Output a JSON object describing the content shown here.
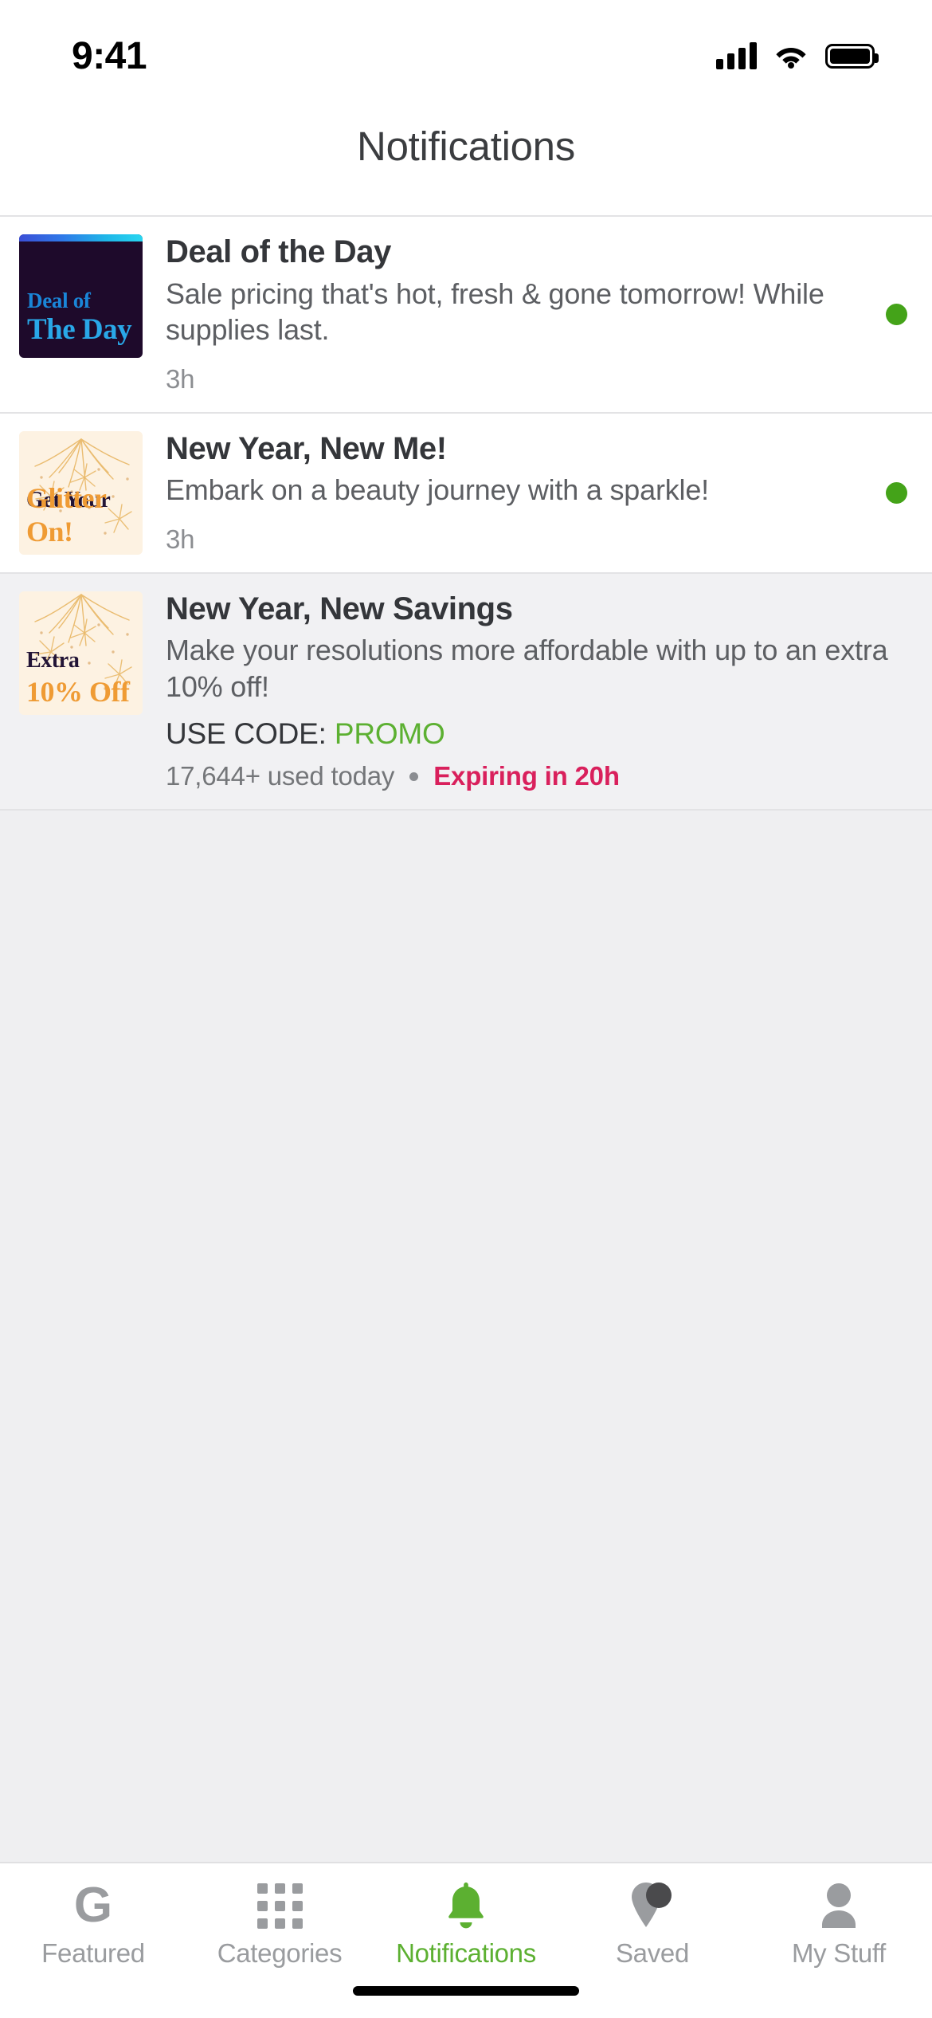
{
  "status_bar": {
    "time": "9:41",
    "cellular_icon": "cellular-signal-icon",
    "wifi_icon": "wifi-icon",
    "battery_icon": "battery-full-icon"
  },
  "header": {
    "title": "Notifications"
  },
  "notifications": [
    {
      "id": "deal-of-the-day",
      "read": false,
      "thumbnail": {
        "type": "deal-banner",
        "line1": "Deal of",
        "line2": "The Day",
        "bg_color": "#1e0a2b",
        "line1_color": "#1a86d8",
        "line2_color": "#29a8e8",
        "accent_gradient_from": "#3b4fd6",
        "accent_gradient_to": "#29d6f0"
      },
      "title": "Deal of the Day",
      "text": "Sale pricing that's hot, fresh & gone tomorrow! While supplies last.",
      "time": "3h",
      "unread_dot_color": "#44a319"
    },
    {
      "id": "new-year-new-me",
      "read": false,
      "thumbnail": {
        "type": "firework-banner",
        "line1": "Get Your",
        "line2": "Glitter On!",
        "bg_color": "#fdf2e2",
        "line1_color": "#221436",
        "line2_color": "#ef9b34"
      },
      "title": "New Year, New Me!",
      "text": "Embark on a beauty journey with a sparkle!",
      "time": "3h",
      "unread_dot_color": "#44a319"
    },
    {
      "id": "new-year-new-savings",
      "read": true,
      "thumbnail": {
        "type": "firework-banner",
        "line1": "Extra",
        "line2": "10% Off",
        "bg_color": "#fdf2e2",
        "line1_color": "#221436",
        "line2_color": "#ef9b34"
      },
      "title": "New Year, New Savings",
      "text": "Make your resolutions more affordable with up to an extra 10% off!",
      "promo": {
        "label": "USE CODE:",
        "code": "PROMO",
        "code_color": "#5cb031",
        "used_text": "17,644+ used today",
        "expiry_text": "Expiring in 20h",
        "expiry_color": "#d9205c"
      }
    }
  ],
  "tabbar": {
    "items": [
      {
        "label": "Featured",
        "icon": "g-logo-icon",
        "active": false
      },
      {
        "label": "Categories",
        "icon": "grid-icon",
        "active": false
      },
      {
        "label": "Notifications",
        "icon": "bell-icon",
        "active": true
      },
      {
        "label": "Saved",
        "icon": "tag-pin-icon",
        "active": false
      },
      {
        "label": "My Stuff",
        "icon": "person-icon",
        "active": false
      }
    ],
    "active_color": "#5cb031",
    "inactive_color": "#9a9c9f"
  }
}
